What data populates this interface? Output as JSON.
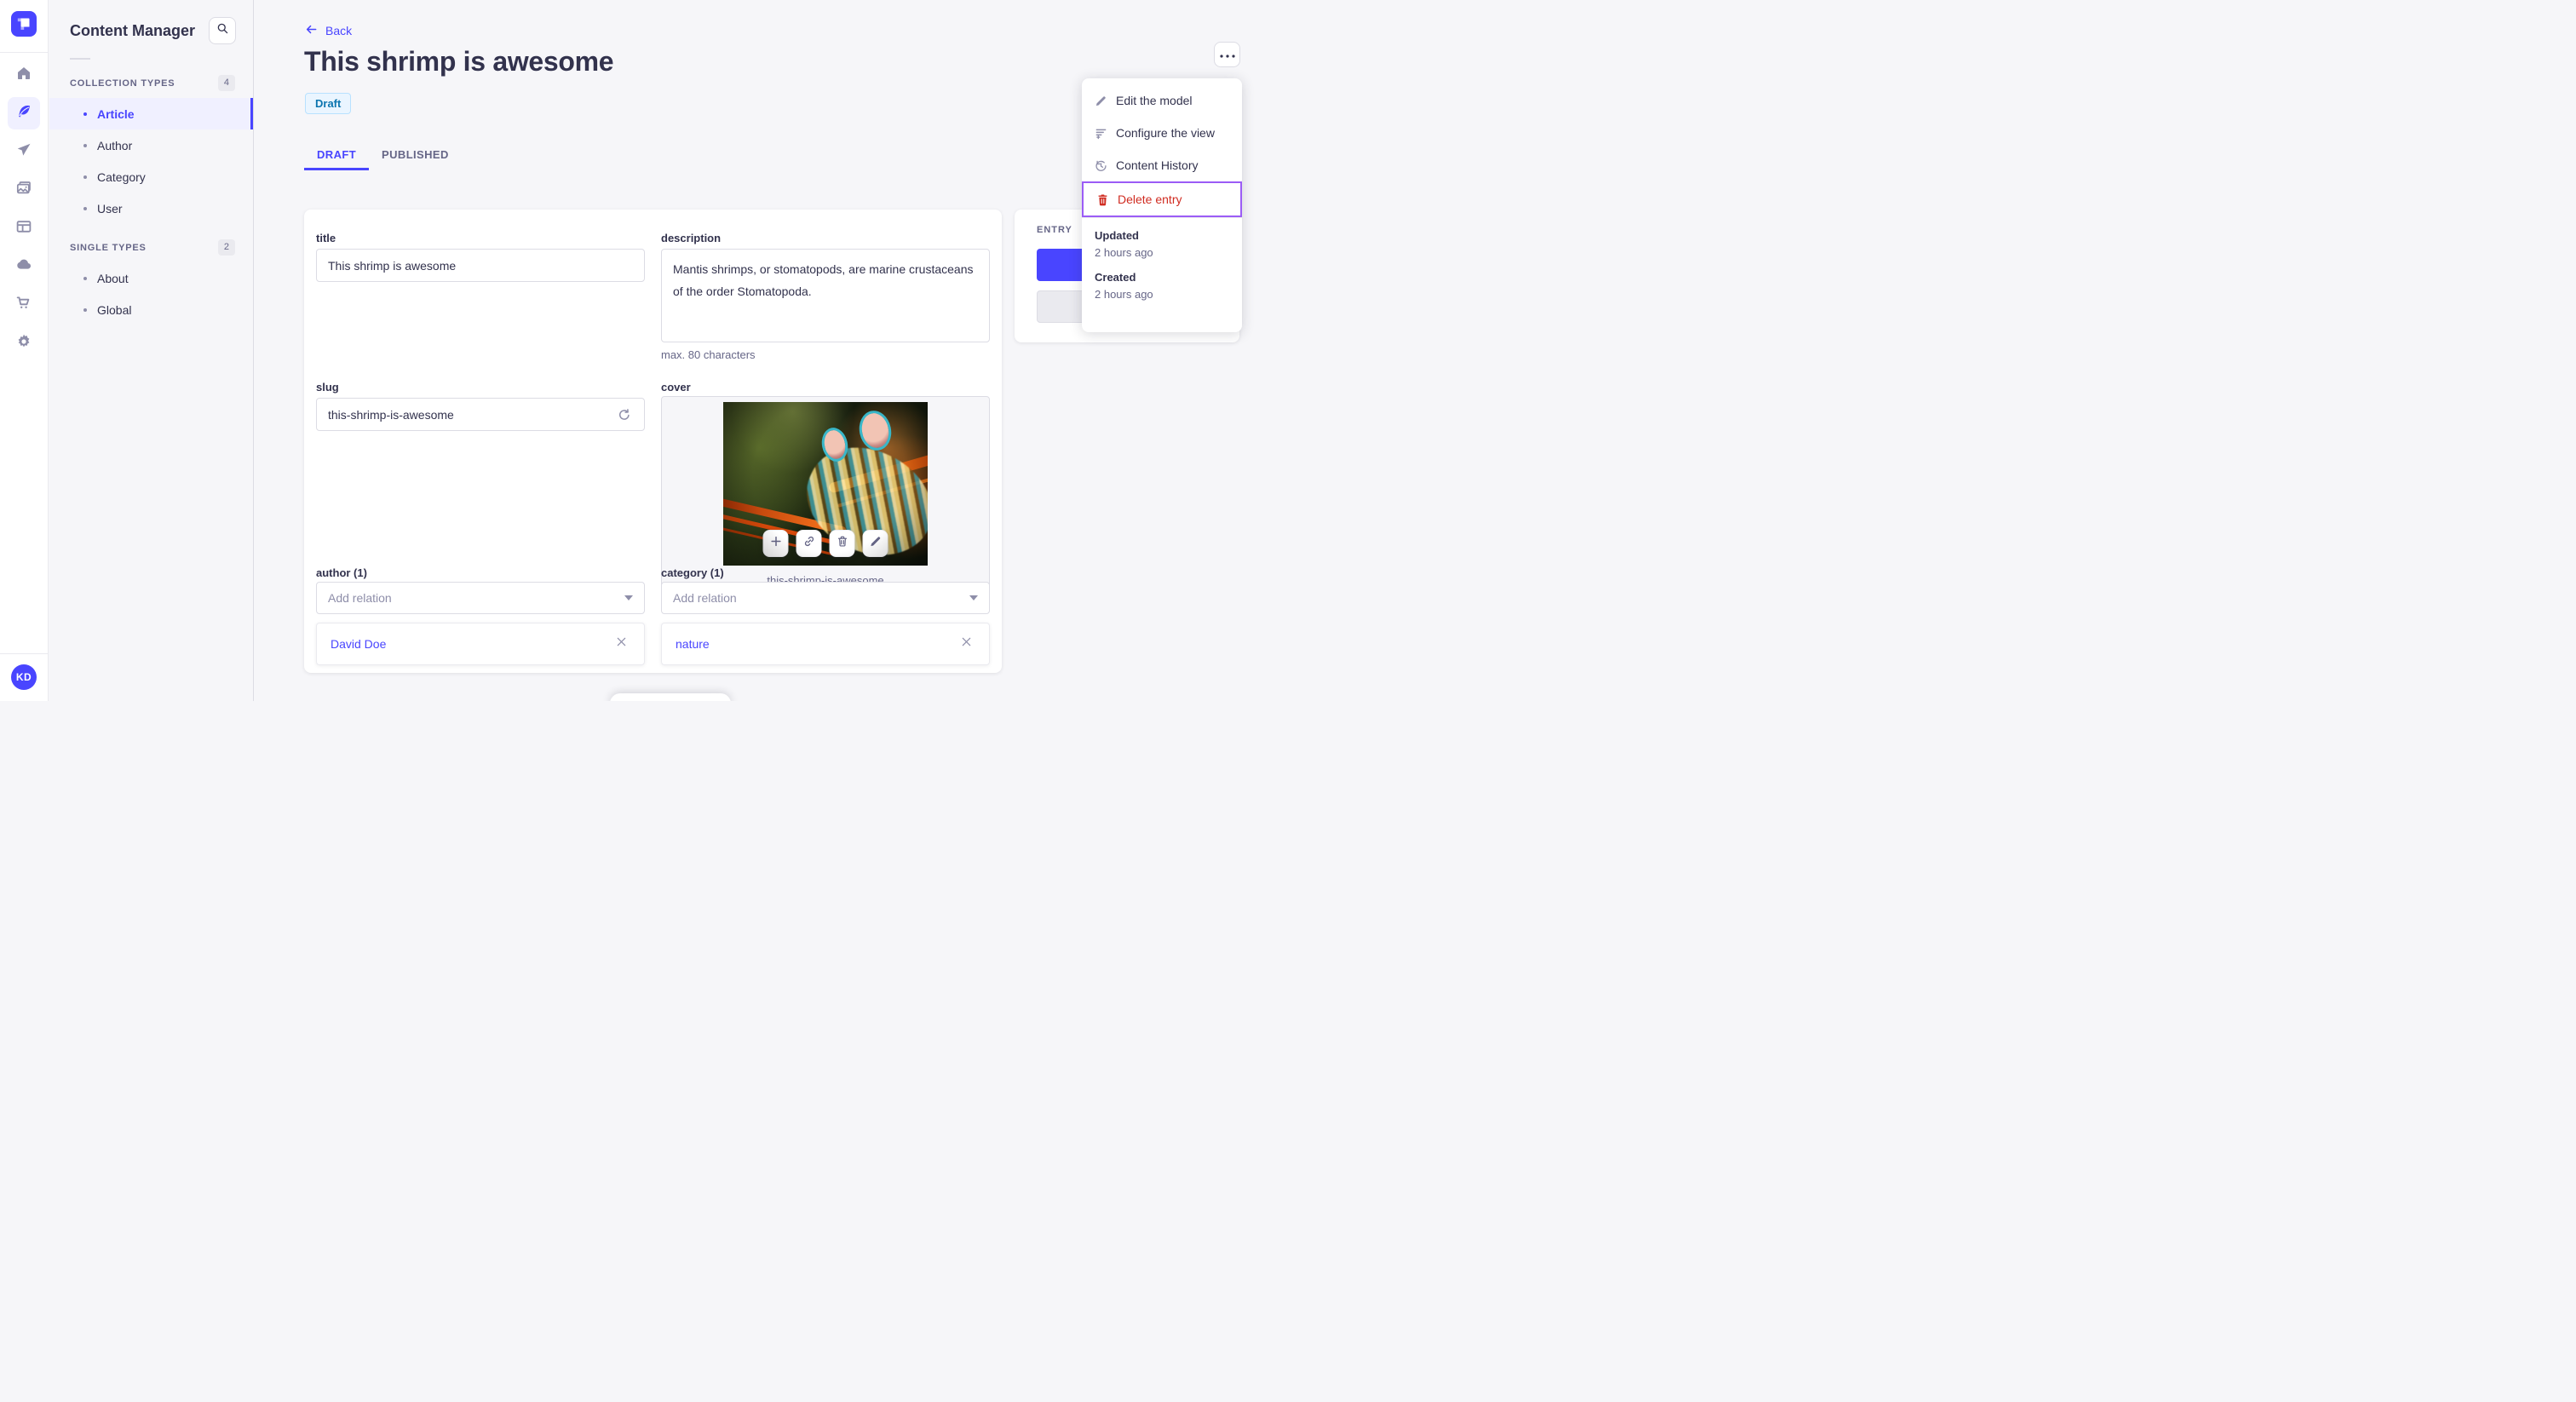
{
  "colors": {
    "accent": "#4945ff",
    "accent_bg": "#f0f0ff",
    "danger": "#d02b20",
    "focus_ring": "#9b5cf6",
    "draft_bg": "#eaf5ff",
    "draft_border": "#b8e1ff",
    "draft_text": "#0c75af"
  },
  "nav": {
    "logo_icon": "strapi-logo",
    "items": [
      {
        "icon": "home-icon",
        "active": false
      },
      {
        "icon": "content-feather-icon",
        "active": true
      },
      {
        "icon": "send-icon",
        "active": false
      },
      {
        "icon": "media-images-icon",
        "active": false
      },
      {
        "icon": "layout-icon",
        "active": false
      },
      {
        "icon": "cloud-icon",
        "active": false
      },
      {
        "icon": "cart-icon",
        "active": false
      },
      {
        "icon": "gear-icon",
        "active": false
      }
    ],
    "avatar_initials": "KD"
  },
  "subnav": {
    "title": "Content Manager",
    "sections": [
      {
        "label": "COLLECTION TYPES",
        "count": "4",
        "items": [
          {
            "label": "Article",
            "active": true
          },
          {
            "label": "Author",
            "active": false
          },
          {
            "label": "Category",
            "active": false
          },
          {
            "label": "User",
            "active": false
          }
        ]
      },
      {
        "label": "SINGLE TYPES",
        "count": "2",
        "items": [
          {
            "label": "About",
            "active": false
          },
          {
            "label": "Global",
            "active": false
          }
        ]
      }
    ]
  },
  "header": {
    "back_label": "Back",
    "title": "This shrimp is awesome",
    "status_badge": "Draft",
    "tabs": [
      {
        "label": "DRAFT",
        "active": true
      },
      {
        "label": "PUBLISHED",
        "active": false
      }
    ]
  },
  "context_menu": {
    "items": [
      {
        "label": "Edit the model",
        "icon": "pencil-icon"
      },
      {
        "label": "Configure the view",
        "icon": "configure-list-icon"
      },
      {
        "label": "Content History",
        "icon": "history-clock-icon"
      },
      {
        "label": "Delete entry",
        "icon": "trash-icon"
      }
    ],
    "meta": [
      {
        "label": "Updated",
        "value": "2 hours ago"
      },
      {
        "label": "Created",
        "value": "2 hours ago"
      }
    ]
  },
  "entry_panel": {
    "title": "ENTRY"
  },
  "form": {
    "title_field": {
      "label": "title",
      "value": "This shrimp is awesome"
    },
    "description_field": {
      "label": "description",
      "value": "Mantis shrimps, or stomatopods, are marine crustaceans of the order Stomatopoda.",
      "hint": "max. 80 characters"
    },
    "slug_field": {
      "label": "slug",
      "value": "this-shrimp-is-awesome"
    },
    "cover_field": {
      "label": "cover",
      "filename": "this-shrimp-is-awesome"
    },
    "author_field": {
      "label": "author (1)",
      "placeholder": "Add relation",
      "relations": [
        {
          "label": "David Doe"
        }
      ]
    },
    "category_field": {
      "label": "category (1)",
      "placeholder": "Add relation",
      "relations": [
        {
          "label": "nature"
        }
      ]
    }
  }
}
